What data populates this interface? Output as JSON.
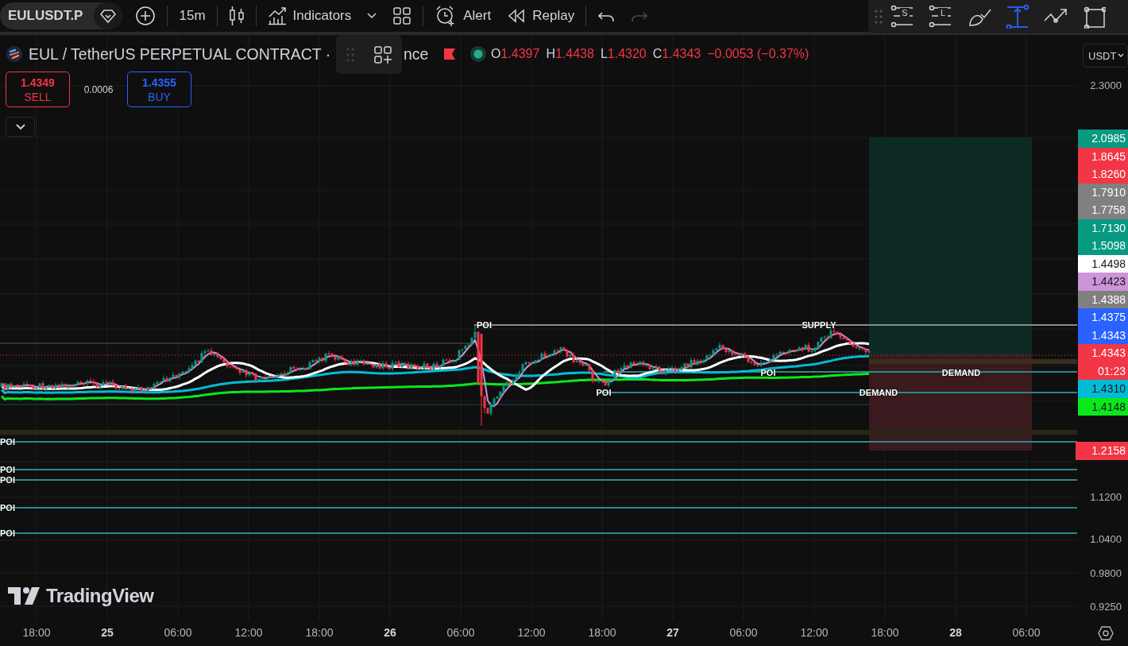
{
  "toolbar": {
    "symbol": "EULUSDT.P",
    "interval": "15m",
    "indicators": "Indicators",
    "alert": "Alert",
    "replay": "Replay",
    "history": [
      {
        "kind": "undo",
        "disabled": false
      },
      {
        "kind": "redo",
        "disabled": true
      }
    ]
  },
  "drawing_tools": [
    {
      "kind": "short",
      "label": "S",
      "selected": false
    },
    {
      "kind": "long",
      "label": "L",
      "selected": false
    },
    {
      "kind": "brush",
      "selected": false
    },
    {
      "kind": "measure",
      "selected": true
    },
    {
      "kind": "path",
      "selected": false
    },
    {
      "kind": "rect",
      "selected": false
    }
  ],
  "legend": {
    "title": "EUL / TetherUS PERPETUAL CONTRACT ·",
    "title_tail": "nce",
    "ohlc": [
      {
        "label": "O",
        "value": "1.4397"
      },
      {
        "label": "H",
        "value": "1.4438"
      },
      {
        "label": "L",
        "value": "1.4320"
      },
      {
        "label": "C",
        "value": "1.4343"
      }
    ],
    "change": "−0.0053 (−0.37%)"
  },
  "trade": {
    "sell": {
      "price": "1.4349",
      "label": "SELL"
    },
    "spread": "0.0006",
    "buy": {
      "price": "1.4355",
      "label": "BUY"
    }
  },
  "chart_labels": [
    "POI",
    "SUPPLY",
    "POI",
    "DEMAND",
    "POI",
    "DEMAND",
    "POI",
    "POI",
    "POI",
    "POI",
    "POI"
  ],
  "logo": "TradingView",
  "price_axis": {
    "currency": "USDT",
    "ticks": [
      {
        "text": "2.3000"
      },
      {
        "text": "1.1200"
      },
      {
        "text": "1.0400"
      },
      {
        "text": "0.9800"
      },
      {
        "text": "0.9250"
      }
    ],
    "tags": [
      {
        "text": "2.0985",
        "color": "#089981"
      },
      {
        "text": "1.8645",
        "color": "#f23645"
      },
      {
        "text": "1.8260",
        "color": "#f23645"
      },
      {
        "text": "1.7910",
        "color": "#808080"
      },
      {
        "text": "1.7758",
        "color": "#808080"
      },
      {
        "text": "1.7130",
        "color": "#089981"
      },
      {
        "text": "1.5098",
        "color": "#089981"
      },
      {
        "text": "1.4498",
        "color": "#ffffff"
      },
      {
        "text": "1.4423",
        "color": "#ce93d8"
      },
      {
        "text": "1.4388",
        "color": "#808080"
      },
      {
        "text": "1.4375",
        "color": "#2962ff"
      },
      {
        "text": "1.4343",
        "color": "#2962ff"
      },
      {
        "text": "1.4343",
        "sub": "01:23",
        "color": "#f23645"
      },
      {
        "text": "1.4310",
        "color": "#00bcd4"
      },
      {
        "text": "1.4148",
        "color": "#0be81a"
      }
    ],
    "stop_tag": {
      "text": "1.2158",
      "color": "#f23645"
    }
  },
  "time_axis": [
    {
      "text": "18:00",
      "kind": "time"
    },
    {
      "text": "25",
      "kind": "day"
    },
    {
      "text": "06:00",
      "kind": "time"
    },
    {
      "text": "12:00",
      "kind": "time"
    },
    {
      "text": "18:00",
      "kind": "time"
    },
    {
      "text": "26",
      "kind": "day"
    },
    {
      "text": "06:00",
      "kind": "time"
    },
    {
      "text": "12:00",
      "kind": "time"
    },
    {
      "text": "18:00",
      "kind": "time"
    },
    {
      "text": "27",
      "kind": "day"
    },
    {
      "text": "06:00",
      "kind": "time"
    },
    {
      "text": "12:00",
      "kind": "time"
    },
    {
      "text": "18:00",
      "kind": "time"
    },
    {
      "text": "28",
      "kind": "day"
    },
    {
      "text": "06:00",
      "kind": "time"
    }
  ]
}
